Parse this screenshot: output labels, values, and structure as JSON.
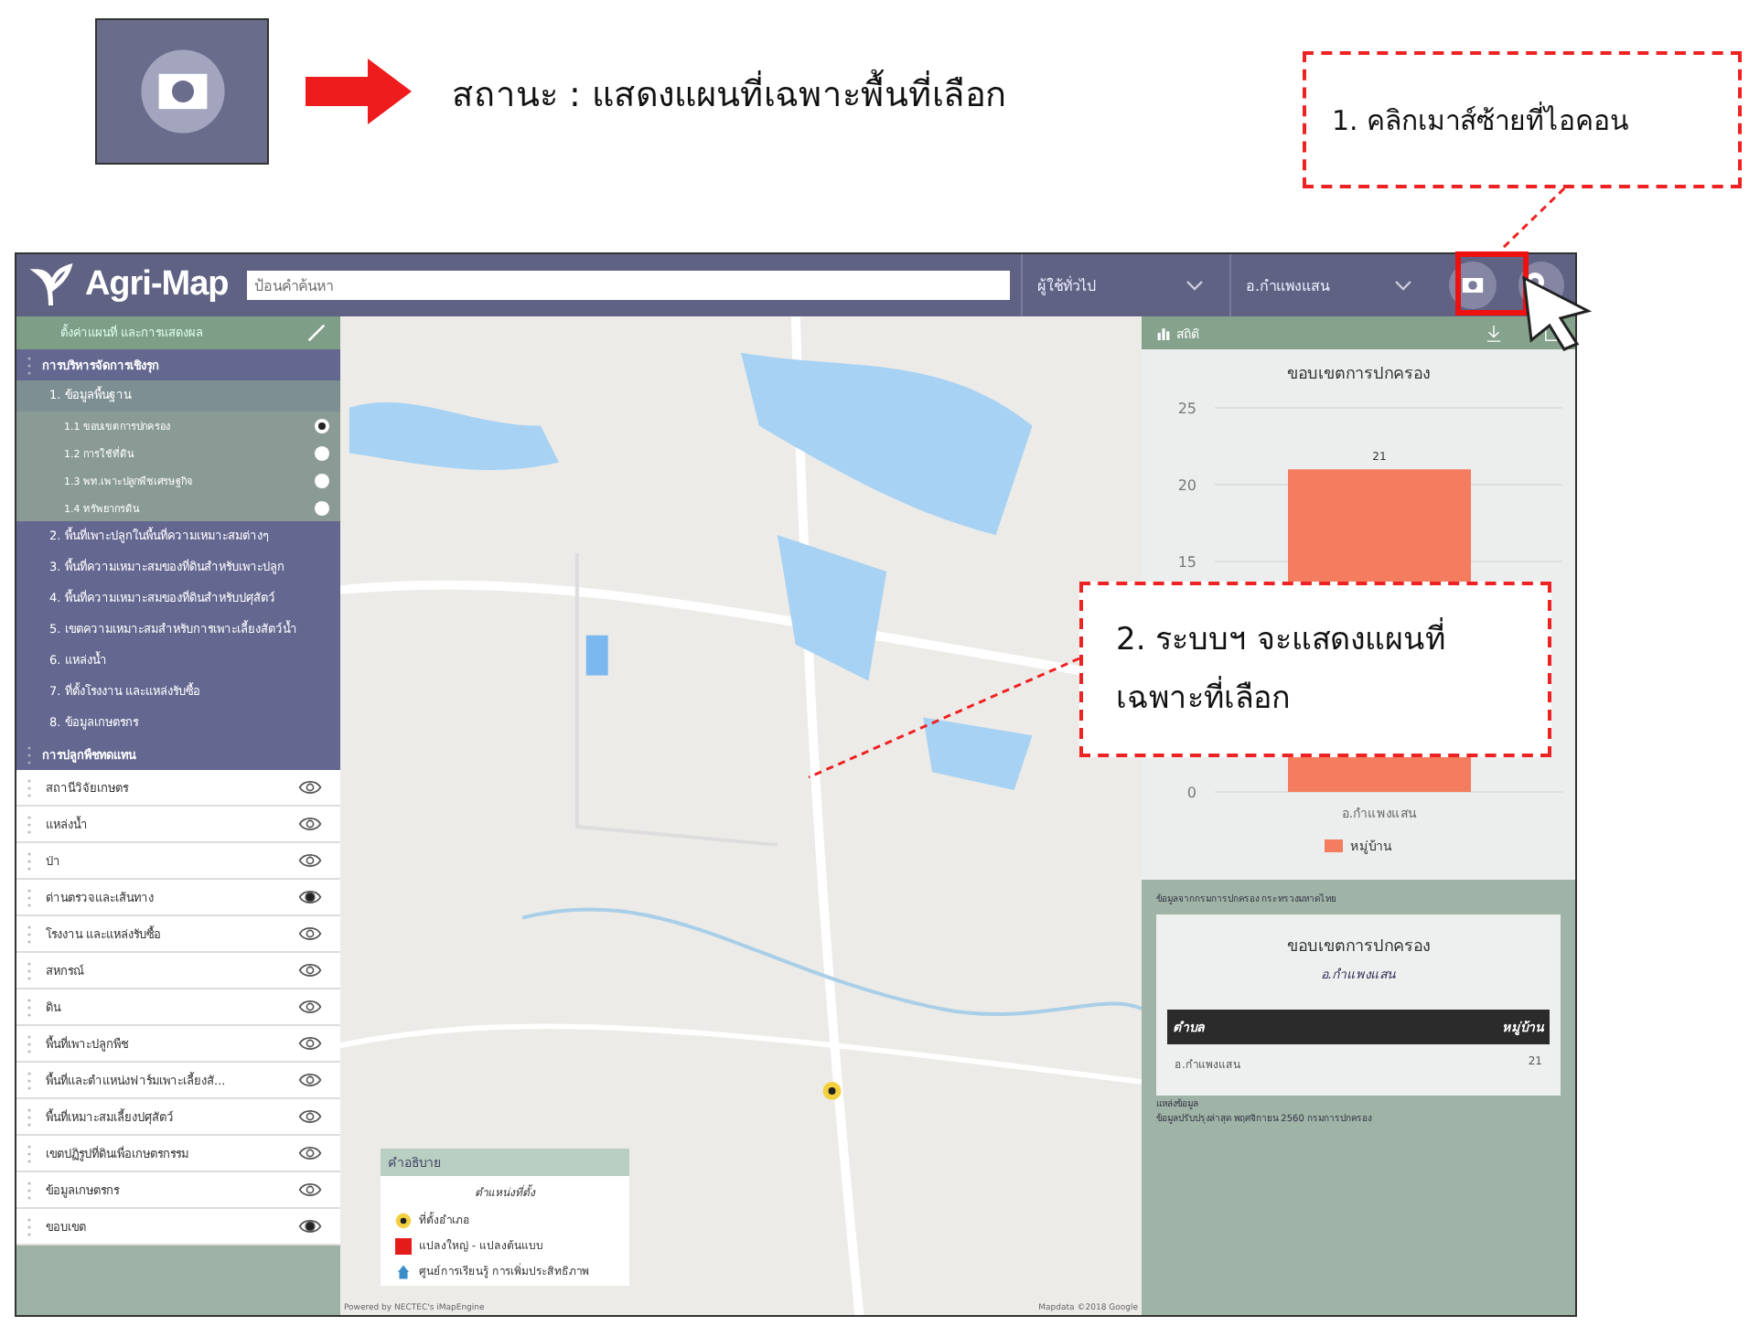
{
  "status_legend": {
    "text": "สถานะ : แสดงแผนที่เฉพาะพื้นที่เลือก"
  },
  "callouts": [
    {
      "text": "1. คลิกเมาส์ซ้ายที่ไอคอน"
    },
    {
      "text": "2. ระบบฯ จะแสดงแผนที่\nเฉพาะที่เลือก"
    }
  ],
  "app": {
    "title": "Agri-Map",
    "search": {
      "placeholder": "ป้อนคำค้นหา"
    },
    "dropdowns": [
      "ผู้ใช้ทั่วไป",
      "อ.กำแพงแสน"
    ]
  },
  "sidebar": {
    "header": "ตั้งค่าแผนที่ และการแสดงผล",
    "sections": [
      {
        "label": "การบริหารจัดการเชิงรุก",
        "children": [
          {
            "label": "1. ข้อมูลพื้นฐาน",
            "selected": true,
            "children": [
              {
                "label": "1.1 ขอบเขตการปกครอง",
                "selected": true
              },
              {
                "label": "1.2 การใช้ที่ดิน",
                "selected": false
              },
              {
                "label": "1.3 พท.เพาะปลูกพืชเศรษฐกิจ",
                "selected": false
              },
              {
                "label": "1.4 ทรัพยากรดิน",
                "selected": false
              }
            ]
          },
          {
            "label": "2. พื้นที่เพาะปลูกในพื้นที่ความเหมาะสมต่างๆ",
            "selected": false
          },
          {
            "label": "3. พื้นที่ความเหมาะสมของที่ดินสำหรับเพาะปลูก",
            "selected": false
          },
          {
            "label": "4. พื้นที่ความเหมาะสมของที่ดินสำหรับปศุสัตว์",
            "selected": false
          },
          {
            "label": "5. เขตความเหมาะสมสำหรับการเพาะเลี้ยงสัตว์น้ำ",
            "selected": false
          },
          {
            "label": "6. แหล่งน้ำ",
            "selected": false
          },
          {
            "label": "7. ที่ตั้งโรงงาน และแหล่งรับซื้อ",
            "selected": false
          },
          {
            "label": "8. ข้อมูลเกษตรกร",
            "selected": false
          }
        ]
      },
      {
        "label": "การปลูกพืชทดแทน"
      }
    ],
    "layers": [
      {
        "label": "สถานีวิจัยเกษตร",
        "visible": false
      },
      {
        "label": "แหล่งน้ำ",
        "visible": false
      },
      {
        "label": "ป่า",
        "visible": false
      },
      {
        "label": "ด่านตรวจและเส้นทาง",
        "visible": true
      },
      {
        "label": "โรงงาน และแหล่งรับซื้อ",
        "visible": false
      },
      {
        "label": "สหกรณ์",
        "visible": false
      },
      {
        "label": "ดิน",
        "visible": false
      },
      {
        "label": "พื้นที่เพาะปลูกพืช",
        "visible": false
      },
      {
        "label": "พื้นที่และตำแหน่งฟาร์มเพาะเลี้ยงสั...",
        "visible": false
      },
      {
        "label": "พื้นที่เหมาะสมเลี้ยงปศุสัตว์",
        "visible": false
      },
      {
        "label": "เขตปฏิรูปที่ดินเพื่อเกษตรกรรม",
        "visible": false
      },
      {
        "label": "ข้อมูลเกษตรกร",
        "visible": false
      },
      {
        "label": "ขอบเขต",
        "visible": true
      }
    ]
  },
  "map": {
    "legend": {
      "title": "คำอธิบาย",
      "subtitle": "ตำแหน่งที่ตั้ง",
      "items": [
        {
          "kind": "marker",
          "label": "ที่ตั้งอำเภอ"
        },
        {
          "kind": "square",
          "label": "แปลงใหญ่ - แปลงต้นแบบ"
        },
        {
          "kind": "pin",
          "label": "ศูนย์การเรียนรู้ การเพิ่มประสิทธิภาพ"
        }
      ]
    },
    "attribution": [
      "Powered by NECTEC's iMapEngine",
      "Mapdata ©2018 Google"
    ]
  },
  "stats": {
    "tab": "สถิติ",
    "chart_data": {
      "type": "bar",
      "title": "ขอบเขตการปกครอง",
      "categories": [
        "อ.กำแพงแสน"
      ],
      "series": [
        {
          "name": "หมู่บ้าน",
          "color": "#f47c5f",
          "values": [
            21
          ]
        }
      ],
      "ylim": [
        0,
        25
      ],
      "yticks": [
        0,
        15,
        20,
        25
      ],
      "data_labels": true
    },
    "source_note": "ข้อมูลจากกรมการปกครอง กระทรวงมหาดไทย",
    "card": {
      "title": "ขอบเขตการปกครอง",
      "subtitle": "อ.กำแพงแสน",
      "columns": [
        "ตำบล",
        "หมู่บ้าน"
      ],
      "rows": [
        [
          "อ.กำแพงแสน",
          "21"
        ]
      ]
    },
    "footer": [
      "แหล่งข้อมูล",
      "ข้อมูลปรับปรุงล่าสุด พฤศจิกายน 2560 กรมการปกครอง"
    ]
  }
}
